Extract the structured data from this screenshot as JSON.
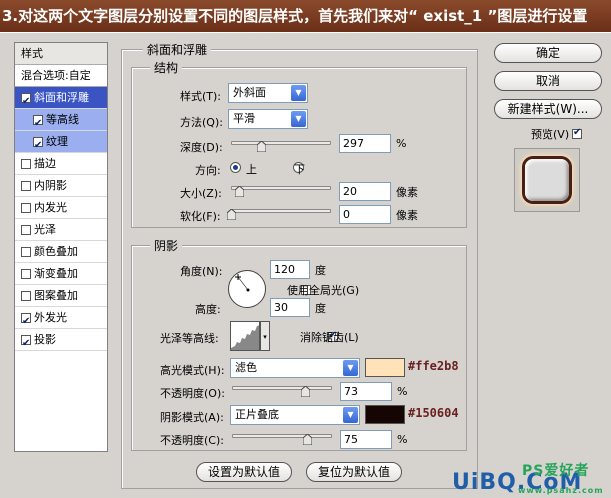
{
  "banner": {
    "text": "3.对这两个文字图层分别设置不同的图层样式，首先我们来对“ exist_1 ”图层进行设置"
  },
  "left_panel": {
    "header": "样式",
    "blend_options": "混合选项:自定",
    "items": [
      {
        "label": "斜面和浮雕",
        "checked": true,
        "state": "selected"
      },
      {
        "label": "等高线",
        "checked": true,
        "state": "sub"
      },
      {
        "label": "纹理",
        "checked": true,
        "state": "sub"
      },
      {
        "label": "描边",
        "checked": false
      },
      {
        "label": "内阴影",
        "checked": false
      },
      {
        "label": "内发光",
        "checked": false
      },
      {
        "label": "光泽",
        "checked": false
      },
      {
        "label": "颜色叠加",
        "checked": false
      },
      {
        "label": "渐变叠加",
        "checked": false
      },
      {
        "label": "图案叠加",
        "checked": false
      },
      {
        "label": "外发光",
        "checked": true
      },
      {
        "label": "投影",
        "checked": true
      }
    ]
  },
  "bevel": {
    "title": "斜面和浮雕",
    "structure": {
      "title": "结构",
      "style_label": "样式(T):",
      "style_value": "外斜面",
      "method_label": "方法(Q):",
      "method_value": "平滑",
      "depth_label": "深度(D):",
      "depth_value": "297",
      "depth_unit": "%",
      "depth_level": 0.3,
      "direction_label": "方向:",
      "direction_up": "上",
      "direction_down": "下",
      "size_label": "大小(Z):",
      "size_value": "20",
      "size_unit": "像素",
      "size_level": 0.08,
      "soften_label": "软化(F):",
      "soften_value": "0",
      "soften_unit": "像素",
      "soften_level": 0.0
    },
    "shading": {
      "title": "阴影",
      "angle_label": "角度(N):",
      "angle_value": "120",
      "angle_unit": "度",
      "global_light_label": "使用全局光(G)",
      "altitude_label": "高度:",
      "altitude_value": "30",
      "altitude_unit": "度",
      "gloss_contour_label": "光泽等高线:",
      "antialias_label": "消除锯齿(L)",
      "highlight_mode_label": "高光模式(H):",
      "highlight_mode_value": "滤色",
      "highlight_color": "#ffe2b8",
      "highlight_color_text": "#ffe2b8",
      "highlight_opacity_label": "不透明度(O):",
      "highlight_opacity_value": "73",
      "highlight_opacity_level": 0.73,
      "shadow_mode_label": "阴影模式(A):",
      "shadow_mode_value": "正片叠底",
      "shadow_color": "#150604",
      "shadow_color_text": "#150604",
      "shadow_opacity_label": "不透明度(C):",
      "shadow_opacity_value": "75",
      "shadow_opacity_level": 0.75,
      "percent": "%"
    },
    "make_default": "设置为默认值",
    "reset_default": "复位为默认值"
  },
  "right": {
    "ok": "确定",
    "cancel": "取消",
    "new_style": "新建样式(W)...",
    "preview_label": "预览(V)"
  },
  "watermark": {
    "main": "UiBQ.CoM",
    "ps": "PS爱好者",
    "site": "www.psahz.com"
  }
}
